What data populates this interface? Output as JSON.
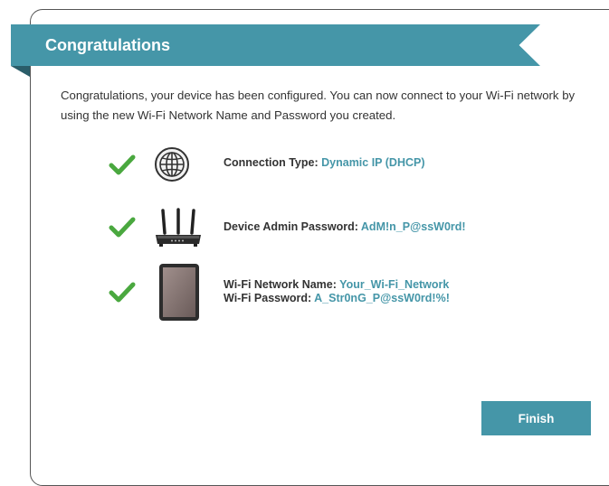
{
  "header": {
    "title": "Congratulations"
  },
  "intro": {
    "text": "Congratulations, your device has been configured. You can now connect to your Wi-Fi network by using the new Wi-Fi Network Name and Password you created."
  },
  "items": [
    {
      "icon": "globe-icon",
      "status_icon": "check-icon",
      "label": "Connection Type:",
      "value": "Dynamic IP (DHCP)"
    },
    {
      "icon": "router-icon",
      "status_icon": "check-icon",
      "label": "Device Admin Password:",
      "value": "AdM!n_P@ssW0rd!"
    },
    {
      "icon": "tablet-icon",
      "status_icon": "check-icon",
      "label": "Wi-Fi Network Name:",
      "value": "Your_Wi-Fi_Network",
      "label2": "Wi-Fi Password:",
      "value2": "A_Str0nG_P@ssW0rd!%!"
    }
  ],
  "actions": {
    "finish_label": "Finish"
  },
  "colors": {
    "accent": "#4596a8",
    "check": "#4aa83f",
    "text": "#333333"
  }
}
